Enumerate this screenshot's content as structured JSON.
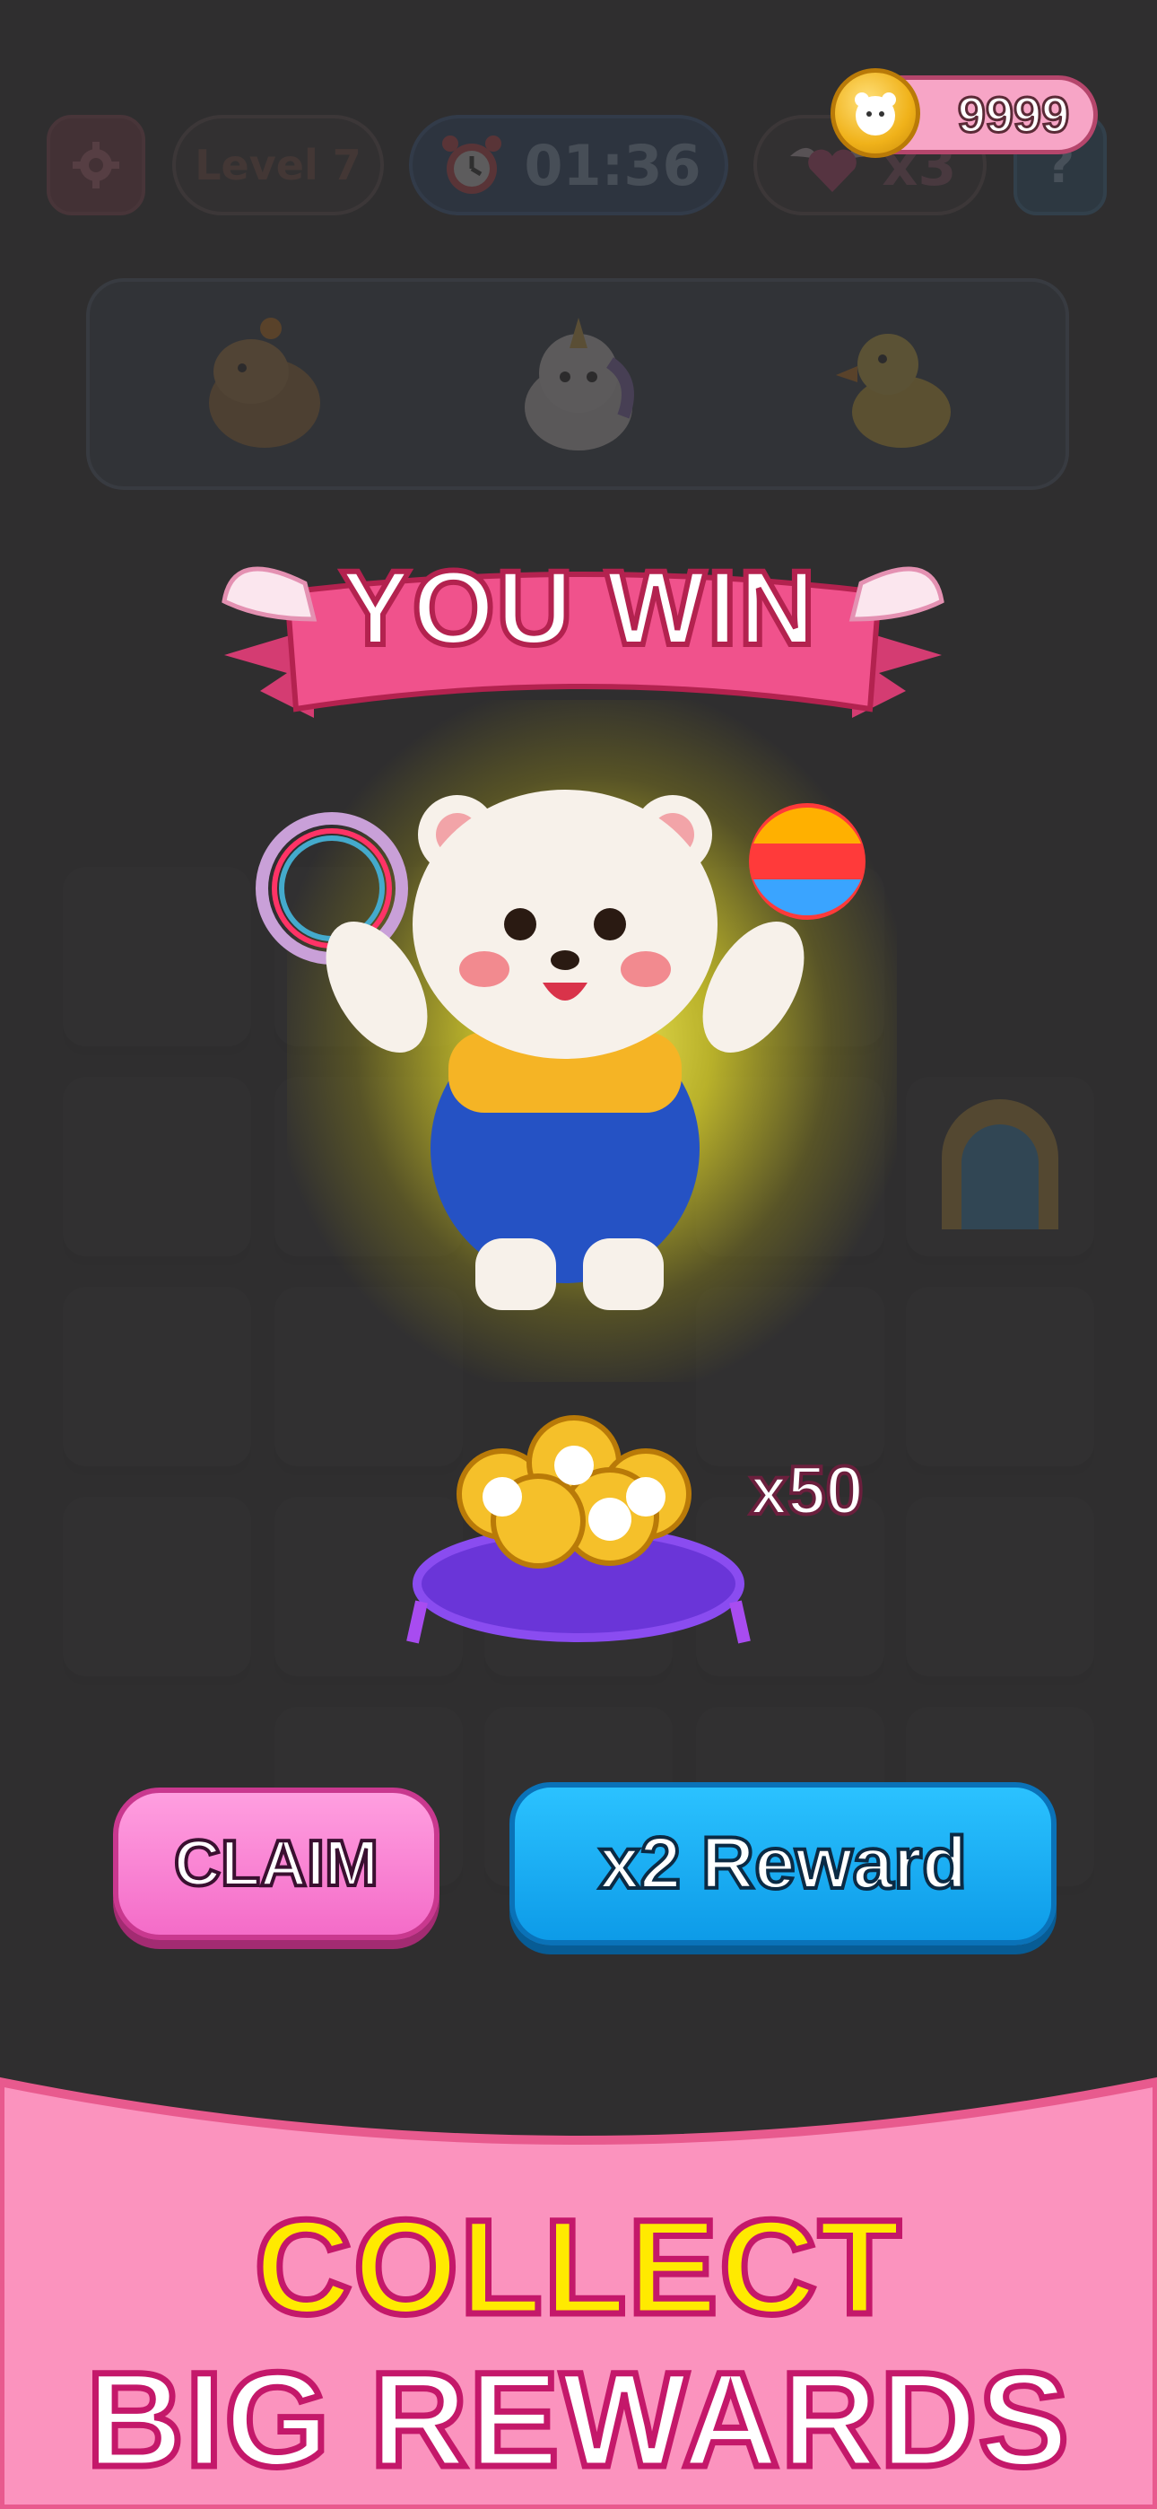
{
  "hud": {
    "level_label": "Level 7",
    "timer": "01:36",
    "lives": "x3",
    "help": "?"
  },
  "coins": {
    "value": "9999"
  },
  "targets": [
    {
      "icon": "capybara-icon"
    },
    {
      "icon": "unicorn-icon"
    },
    {
      "icon": "duck-icon"
    }
  ],
  "win_banner": {
    "title": "YOU WIN"
  },
  "reward": {
    "count": "x50"
  },
  "buttons": {
    "claim": "CLAIM",
    "x2_reward": "x2 Reward"
  },
  "promo": {
    "line1": "COLLECT",
    "line2": "BIG REWARDS"
  },
  "colors": {
    "banner_pink": "#f0528c",
    "claim_pink": "#f46cc8",
    "reward_blue": "#0d9be8",
    "promo_yellow": "#ffea00",
    "bottom_pink": "#fb93be"
  }
}
